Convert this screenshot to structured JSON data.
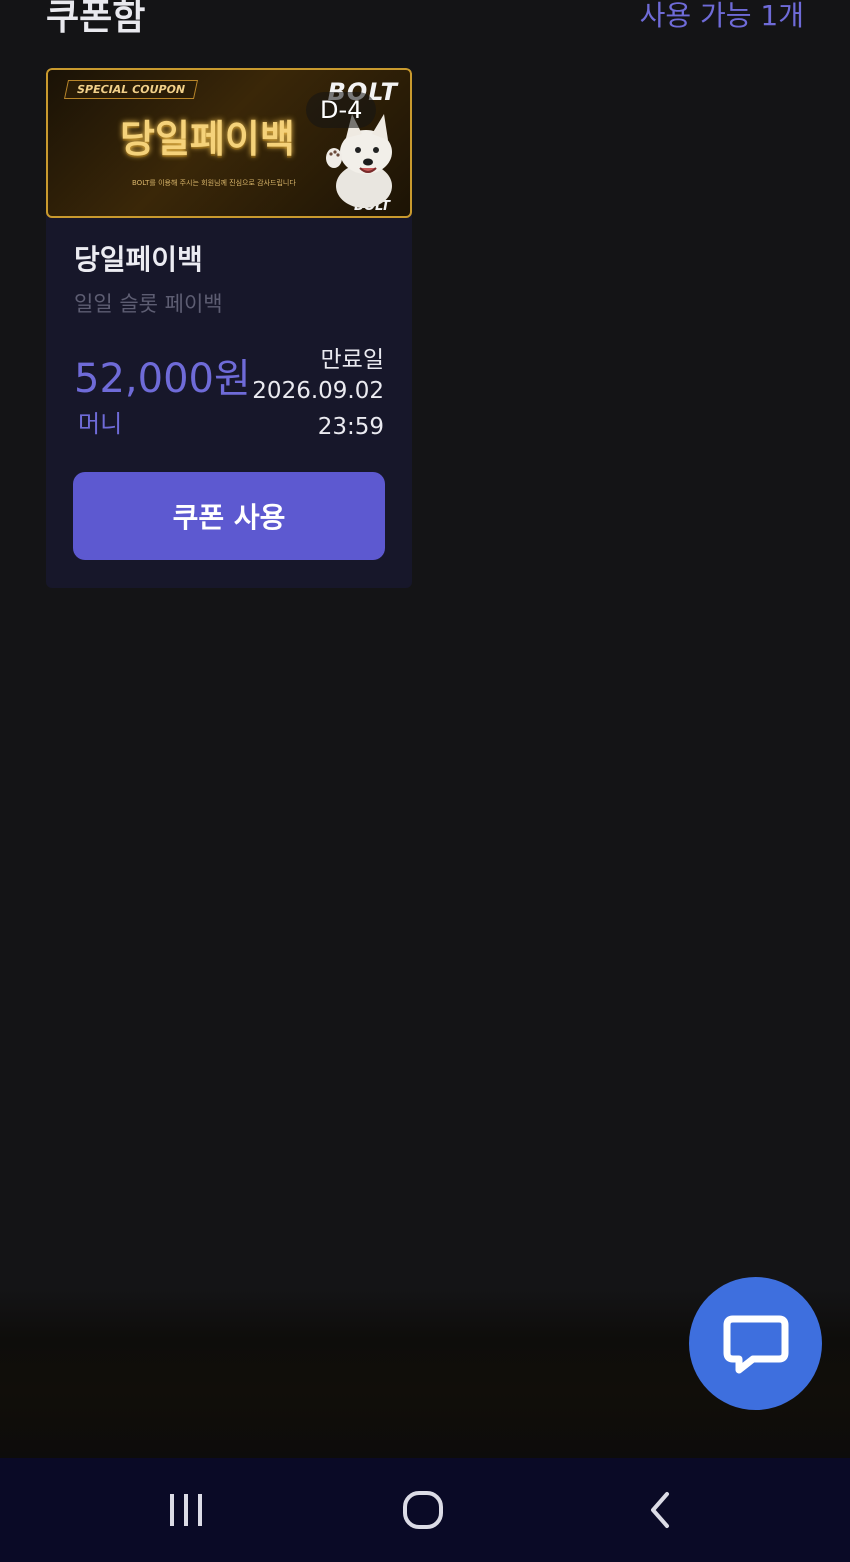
{
  "header": {
    "title": "쿠폰함",
    "available_count": "사용 가능 1개"
  },
  "coupon": {
    "banner": {
      "tag": "SPECIAL COUPON",
      "title": "당일페이백",
      "subtitle": "BOLT를 이용해 주시는 회원님께 진심으로 감사드립니다",
      "brand": "BOLT",
      "d_day": "D-4"
    },
    "name": "당일페이백",
    "description": "일일 슬롯 페이백",
    "amount": "52,000원",
    "amount_type": "머니",
    "expiry_label": "만료일",
    "expiry_date": "2026.09.02",
    "expiry_time": "23:59",
    "use_button_label": "쿠폰 사용"
  },
  "colors": {
    "accent": "#6f6bd8",
    "button": "#5d59d0",
    "chat_fab": "#3e6fde",
    "nav_bar": "#0a0a26"
  },
  "icons": {
    "chat": "chat-bubble-icon",
    "nav_recent": "recent-apps-icon",
    "nav_home": "home-icon",
    "nav_back": "back-icon"
  }
}
